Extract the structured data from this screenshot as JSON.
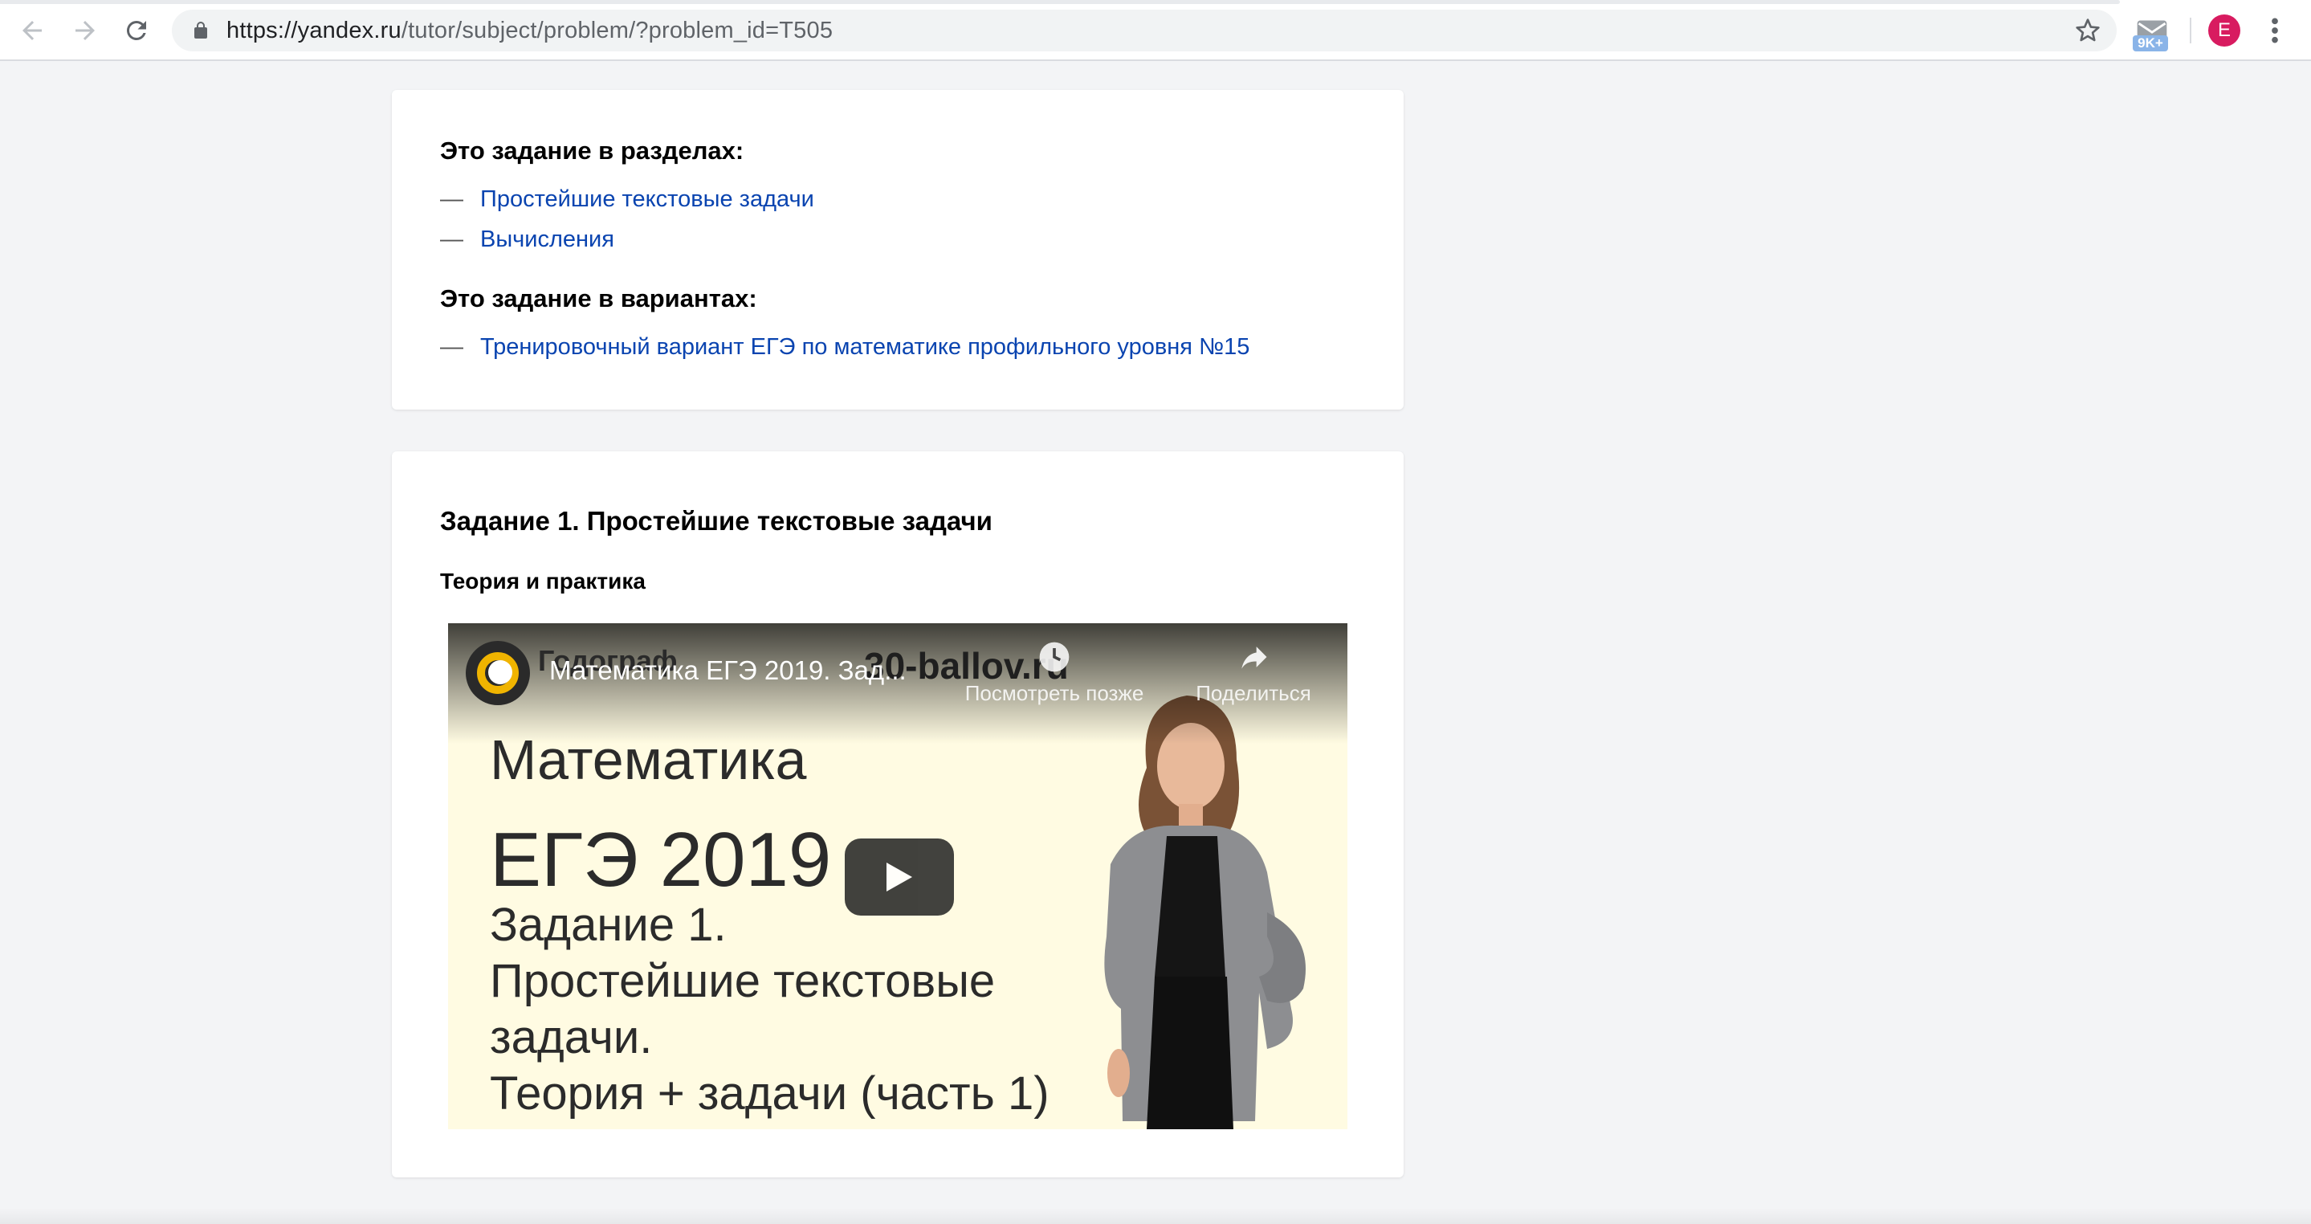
{
  "browser": {
    "url_host": "https://yandex.ru",
    "url_path": "/tutor/subject/problem/?problem_id=T505",
    "extension_badge": "9K+",
    "profile_initial": "E"
  },
  "sections_card": {
    "sections_heading": "Это задание в разделах:",
    "sections": [
      {
        "dash": "—",
        "label": "Простейшие текстовые задачи"
      },
      {
        "dash": "—",
        "label": "Вычисления"
      }
    ],
    "variants_heading": "Это задание в вариантах:",
    "variants": [
      {
        "dash": "—",
        "label": "Тренировочный вариант ЕГЭ по математике профильного уровня №15"
      }
    ]
  },
  "task_card": {
    "title": "Задание 1. Простейшие текстовые задачи",
    "subtitle": "Теория и практика",
    "video": {
      "channel": "Годограф",
      "title": "Математика ЕГЭ 2019. Зад...",
      "site": "30-ballov.ru",
      "watch_later": "Посмотреть позже",
      "share": "Поделиться",
      "thumbnail_lines": [
        "Математика",
        "ЕГЭ 2019",
        "Задание 1.",
        "Простейшие текстовые",
        "задачи.",
        "Теория + задачи (часть 1)"
      ]
    }
  },
  "colors": {
    "link": "#0a44b0",
    "page_bg": "#f3f4f6",
    "thumb_bg": "#fffbe2",
    "avatar": "#d81b60"
  }
}
